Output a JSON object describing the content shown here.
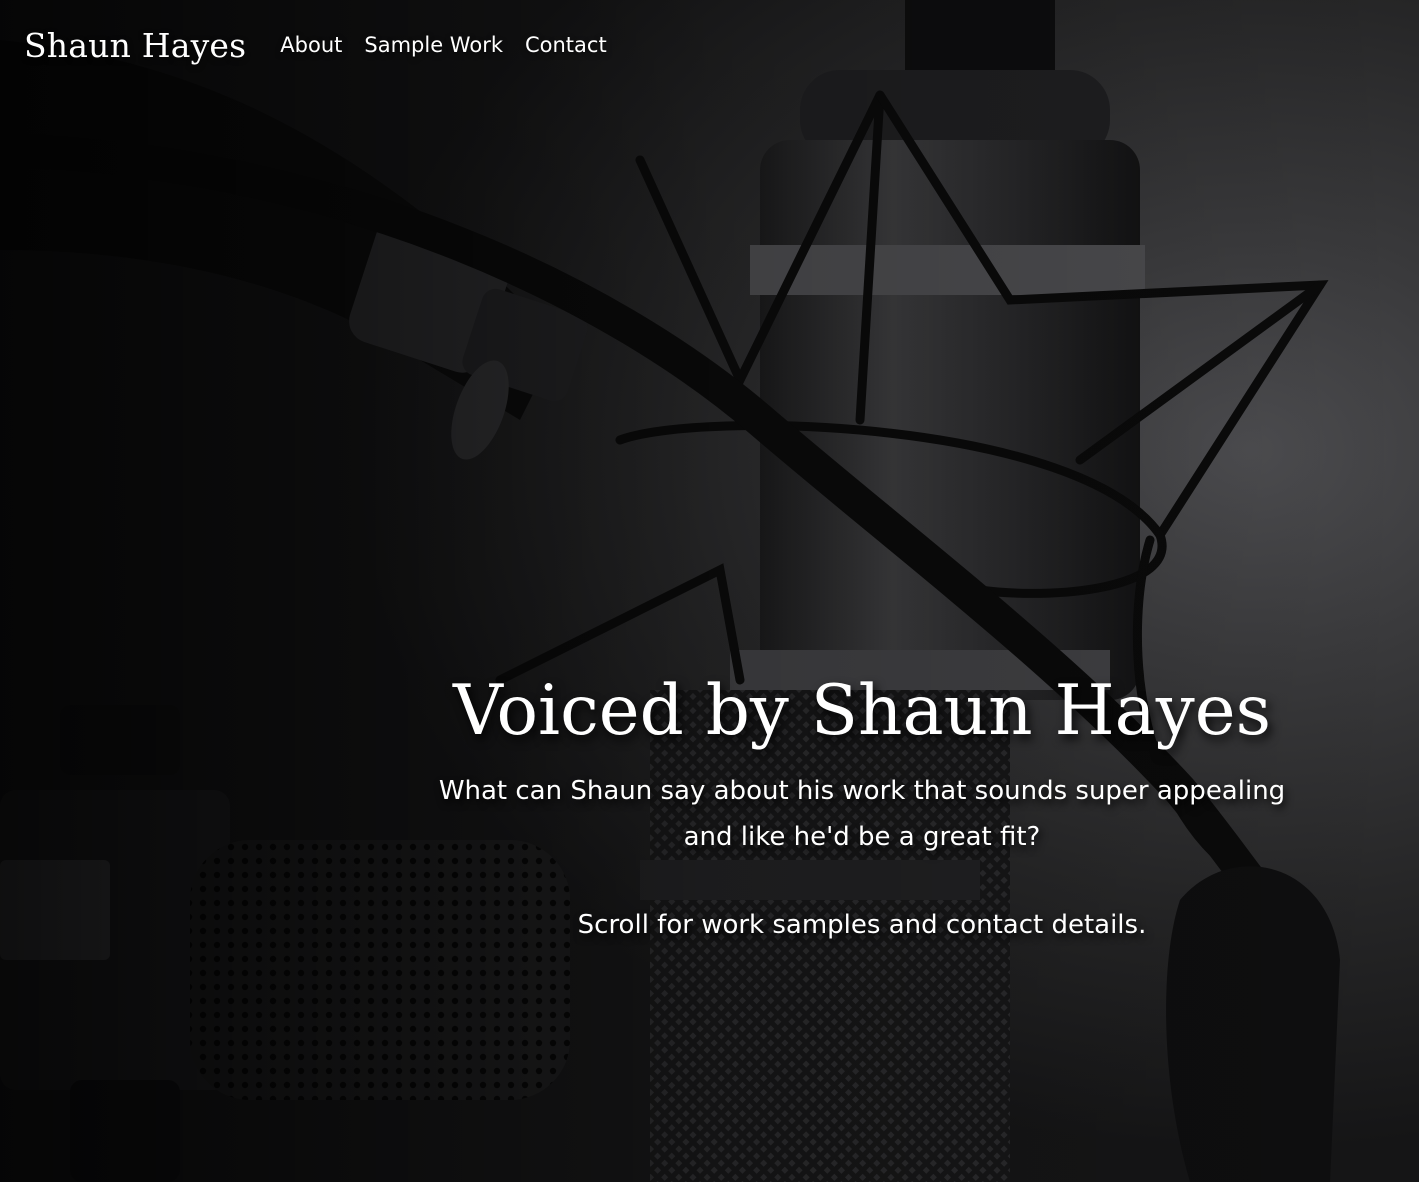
{
  "site": {
    "brand": "Shaun Hayes"
  },
  "nav": {
    "items": [
      {
        "label": "About"
      },
      {
        "label": "Sample Work"
      },
      {
        "label": "Contact"
      }
    ]
  },
  "hero": {
    "title": "Voiced by Shaun Hayes",
    "subtitle": "What can Shaun say about his work that sounds super appealing and like he'd be a great fit?",
    "scroll_hint": "Scroll for work samples and contact details.",
    "background": "studio-microphone-photo"
  },
  "colors": {
    "text": "#ffffff",
    "background_dark": "#151516",
    "background_light": "#4d4d50"
  }
}
